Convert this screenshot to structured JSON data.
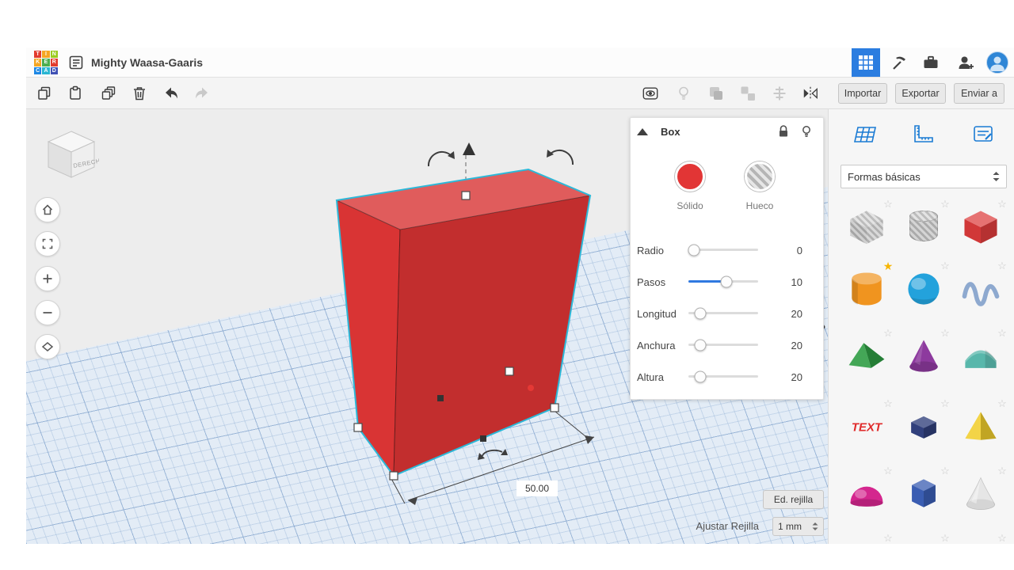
{
  "app": {
    "title": "Mighty Waasa-Gaaris"
  },
  "logo": {
    "letters": [
      "T",
      "I",
      "N",
      "K",
      "E",
      "R",
      "C",
      "A",
      "D"
    ],
    "colors": [
      "#e23b2e",
      "#f5a623",
      "#9acb1e",
      "#f5a623",
      "#4cae4f",
      "#e23b2e",
      "#1e88e5",
      "#29b6d2",
      "#3f51b5"
    ]
  },
  "toolbar": {
    "import_label": "Importar",
    "export_label": "Exportar",
    "send_label": "Enviar a"
  },
  "inspector": {
    "title": "Box",
    "solid_label": "Sólido",
    "hole_label": "Hueco",
    "solid_color": "#e23535",
    "accent_color": "#3079e0",
    "sliders": [
      {
        "label": "Radio",
        "value": "0",
        "pos": "8%",
        "fill": "0%"
      },
      {
        "label": "Pasos",
        "value": "10",
        "pos": "55%",
        "fill": "55%"
      },
      {
        "label": "Longitud",
        "value": "20",
        "pos": "17%",
        "fill": "0%"
      },
      {
        "label": "Anchura",
        "value": "20",
        "pos": "17%",
        "fill": "0%"
      },
      {
        "label": "Altura",
        "value": "20",
        "pos": "17%",
        "fill": "0%"
      }
    ]
  },
  "canvas": {
    "viewcube_label": "DERECHA",
    "dimension_value": "50.00",
    "edit_grid_label": "Ed. rejilla",
    "snap_label": "Ajustar Rejilla",
    "snap_value": "1 mm",
    "box_color": "#d93434",
    "selection_color": "#2cb8d8"
  },
  "sidebar": {
    "category_label": "Formas básicas",
    "text_shape_label": "TEXT",
    "favorite_color": "#f7b500",
    "shapes": [
      {
        "id": "box-hole",
        "color": "#d8d8d8"
      },
      {
        "id": "cylinder-hole",
        "color": "#d8d8d8"
      },
      {
        "id": "box",
        "color": "#dd3c3c"
      },
      {
        "id": "cylinder",
        "color": "#f0941f"
      },
      {
        "id": "sphere",
        "color": "#23a2dc"
      },
      {
        "id": "scribble",
        "color": "#8ea9cf"
      },
      {
        "id": "roof",
        "color": "#2f9e44"
      },
      {
        "id": "cone",
        "color": "#8d3a9e"
      },
      {
        "id": "round-roof",
        "color": "#58b7ab"
      },
      {
        "id": "text",
        "color": "#e02b2b"
      },
      {
        "id": "polygon",
        "color": "#31407c"
      },
      {
        "id": "pyramid",
        "color": "#f2cf2e"
      },
      {
        "id": "half-sphere",
        "color": "#d4268e"
      },
      {
        "id": "hex-prism",
        "color": "#3a5db2"
      },
      {
        "id": "paraboloid",
        "color": "#e6e6e6"
      }
    ]
  }
}
